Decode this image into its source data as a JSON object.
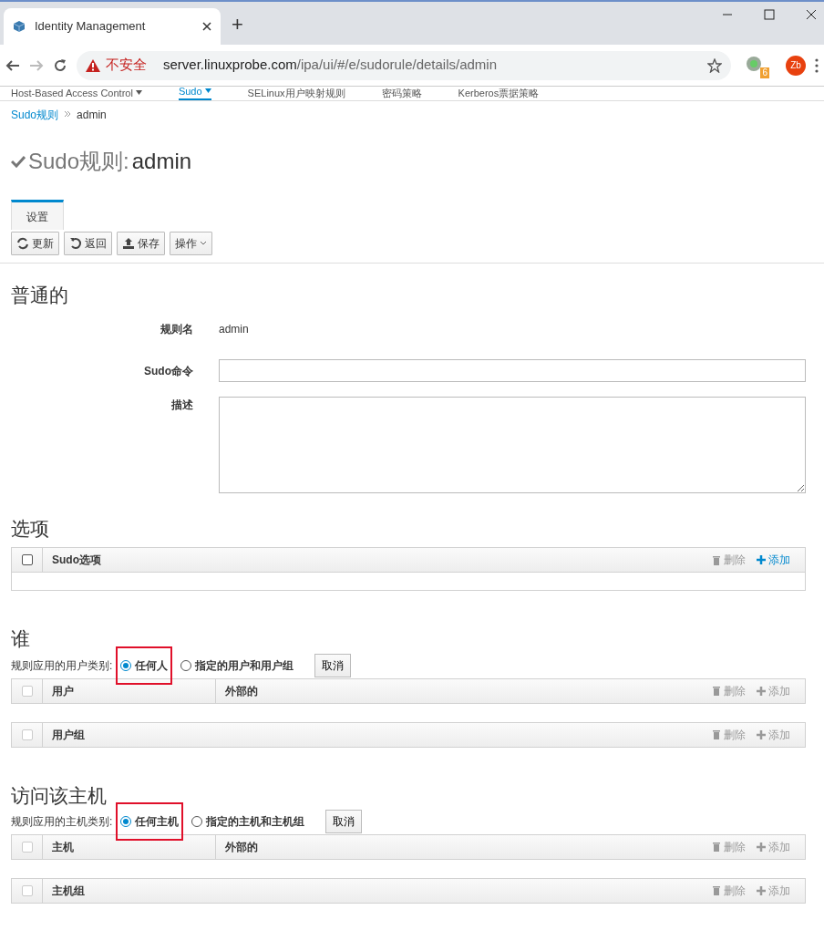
{
  "browser": {
    "tab_title": "Identity Management",
    "new_tab": "+",
    "security_warning": "不安全",
    "url_host": "server.linuxprobe.com",
    "url_path": "/ipa/ui/#/e/sudorule/details/admin",
    "extension_badge": "6",
    "profile": "Zb"
  },
  "nav": [
    {
      "label": "Host-Based Access Control",
      "dropdown": true,
      "selected": false
    },
    {
      "label": "Sudo",
      "dropdown": true,
      "selected": true
    },
    {
      "label": "SELinux用户映射规则",
      "dropdown": false,
      "selected": false
    },
    {
      "label": "密码策略",
      "dropdown": false,
      "selected": false
    },
    {
      "label": "Kerberos票据策略",
      "dropdown": false,
      "selected": false
    }
  ],
  "breadcrumb": {
    "parent": "Sudo规则",
    "current": "admin"
  },
  "page_title": {
    "prefix": "Sudo规则:",
    "name": "admin"
  },
  "facet_tabs": [
    {
      "label": "设置",
      "selected": true
    }
  ],
  "toolbar": [
    {
      "label": "更新",
      "kind": "refresh"
    },
    {
      "label": "返回",
      "kind": "undo"
    },
    {
      "label": "保存",
      "kind": "upload"
    },
    {
      "label": "操作",
      "kind": "menu"
    }
  ],
  "general": {
    "title": "普通的",
    "fields": [
      {
        "label": "规则名",
        "kind": "text",
        "value": "admin"
      },
      {
        "label": "Sudo命令",
        "kind": "input"
      },
      {
        "label": "描述",
        "kind": "textarea"
      }
    ]
  },
  "sections": [
    {
      "title": "选项",
      "tables": [
        {
          "columns": [
            "Sudo选项"
          ],
          "delete": "删除",
          "add": "添加",
          "disabled": false,
          "empty_row": true
        }
      ]
    },
    {
      "title": "谁",
      "category": {
        "label": "规则应用的用户类别:",
        "options": [
          {
            "label": "任何人",
            "selected": true,
            "highlighted": true
          },
          {
            "label": "指定的用户和用户组",
            "selected": false,
            "highlighted": false
          }
        ],
        "cancel": "取消"
      },
      "tables": [
        {
          "columns": [
            "用户",
            "外部的"
          ],
          "delete": "删除",
          "add": "添加",
          "disabled": true,
          "empty_row": false
        },
        {
          "columns": [
            "用户组"
          ],
          "delete": "删除",
          "add": "添加",
          "disabled": true,
          "empty_row": false
        }
      ]
    },
    {
      "title": "访问该主机",
      "category": {
        "label": "规则应用的主机类别:",
        "options": [
          {
            "label": "任何主机",
            "selected": true,
            "highlighted": true
          },
          {
            "label": "指定的主机和主机组",
            "selected": false,
            "highlighted": false
          }
        ],
        "cancel": "取消"
      },
      "tables": [
        {
          "columns": [
            "主机",
            "外部的"
          ],
          "delete": "删除",
          "add": "添加",
          "disabled": true,
          "empty_row": false
        },
        {
          "columns": [
            "主机组"
          ],
          "delete": "删除",
          "add": "添加",
          "disabled": true,
          "empty_row": false
        }
      ]
    }
  ]
}
